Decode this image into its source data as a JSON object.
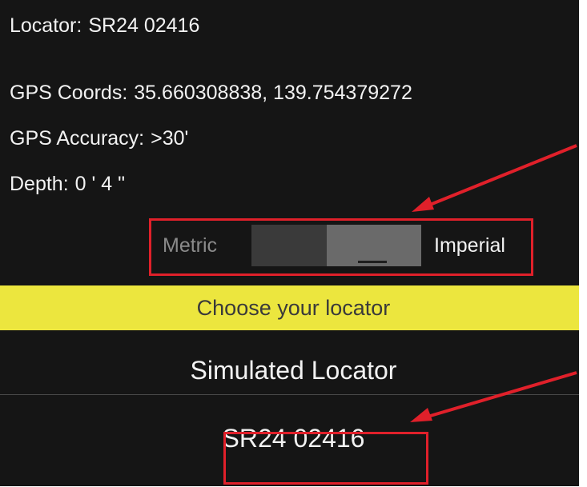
{
  "info": {
    "locator_label": "Locator:",
    "locator_value": "SR24 02416",
    "gps_coords_label": "GPS Coords:",
    "gps_coords_value": "35.660308838, 139.754379272",
    "gps_accuracy_label": "GPS Accuracy:",
    "gps_accuracy_value": ">30'",
    "depth_label": "Depth:",
    "depth_value": "0 ' 4 \""
  },
  "units_toggle": {
    "left_label": "Metric",
    "right_label": "Imperial",
    "selected": "Imperial"
  },
  "chooser": {
    "title": "Choose your locator",
    "items": [
      {
        "label": "Simulated Locator"
      },
      {
        "label": "SR24 02416"
      }
    ]
  },
  "colors": {
    "background": "#151515",
    "banner": "#ece63e",
    "annotation": "#e0202a"
  }
}
